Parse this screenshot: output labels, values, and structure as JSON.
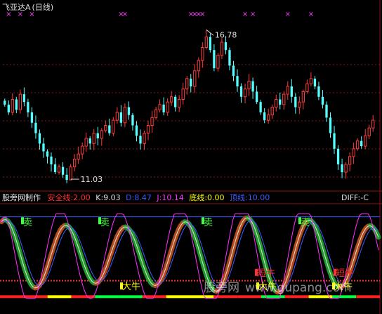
{
  "header": {
    "stock_name": "飞亚达A",
    "period": "(日线)"
  },
  "indicator": {
    "name": "股旁网制作",
    "items": [
      {
        "label": "安全线",
        "value": "2.00",
        "color": "#ff3030"
      },
      {
        "label": "K",
        "value": "9.03",
        "color": "#e0e0e0"
      },
      {
        "label": "D",
        "value": "8.47",
        "color": "#3b5bff"
      },
      {
        "label": "J",
        "value": "10.14",
        "color": "#ff30ff"
      },
      {
        "label": "底线",
        "value": "0.00",
        "color": "#ffff00"
      },
      {
        "label": "顶线",
        "value": "10.00",
        "color": "#3b5bff"
      }
    ],
    "diff_label": "DIFF:-C"
  },
  "watermark": {
    "cn": "股旁网",
    "url": "www.gupang.com"
  },
  "colors": {
    "up": "#ff3b3b",
    "down": "#54ffff",
    "marker": "#ff40ff",
    "grid": "#8b1010",
    "frame": "#8b1010"
  },
  "chart_data": [
    {
      "type": "candlestick",
      "title": "飞亚达A (日线)",
      "annotations": [
        {
          "text": "16.78",
          "kind": "high"
        },
        {
          "text": "11.03",
          "kind": "low"
        }
      ],
      "signal_markers": [
        "×",
        "×",
        "×",
        "×",
        "×",
        "×",
        "×",
        "×",
        "×",
        "×",
        "×",
        "×",
        "×"
      ],
      "closes": [
        13.9,
        13.6,
        14.1,
        13.7,
        14.3,
        14.0,
        13.6,
        13.2,
        12.8,
        12.4,
        12.1,
        11.9,
        11.6,
        11.3,
        11.5,
        11.2,
        11.0,
        11.5,
        11.8,
        12.0,
        12.3,
        12.6,
        12.4,
        12.8,
        12.6,
        12.9,
        13.1,
        12.8,
        13.3,
        13.6,
        13.2,
        13.8,
        13.5,
        13.1,
        12.7,
        12.4,
        12.8,
        13.1,
        13.4,
        13.7,
        13.9,
        13.6,
        14.0,
        14.2,
        13.8,
        14.1,
        14.5,
        14.9,
        14.6,
        15.2,
        15.6,
        16.1,
        16.5,
        16.0,
        15.3,
        15.8,
        16.3,
        16.0,
        15.4,
        15.0,
        14.6,
        14.2,
        14.5,
        14.8,
        14.4,
        14.0,
        13.6,
        13.3,
        13.5,
        13.8,
        14.1,
        13.9,
        14.3,
        14.6,
        14.2,
        13.8,
        14.0,
        14.4,
        14.7,
        14.9,
        14.6,
        14.2,
        13.9,
        13.4,
        12.8,
        12.2,
        11.6,
        11.3,
        11.6,
        11.9,
        12.2,
        12.5,
        12.3,
        12.7,
        13.0,
        13.3
      ]
    },
    {
      "type": "line",
      "title": "股旁网制作",
      "series_names": [
        "K",
        "D",
        "J"
      ],
      "reference_levels": {
        "安全线": 2.0,
        "底线": 0.0,
        "顶线": 10.0
      },
      "latest": {
        "安全线": 2.0,
        "K": 9.03,
        "D": 8.47,
        "J": 10.14,
        "底线": 0.0,
        "顶线": 10.0
      },
      "signals": [
        {
          "text": "卖"
        },
        {
          "text": "卖"
        },
        {
          "text": "卖"
        },
        {
          "text": "卖"
        },
        {
          "text": "大牛"
        },
        {
          "text": "大牛"
        },
        {
          "text": "大牛"
        },
        {
          "text": "短牛"
        },
        {
          "text": "短牛"
        }
      ],
      "ylim": [
        -0.5,
        10.5
      ]
    }
  ]
}
